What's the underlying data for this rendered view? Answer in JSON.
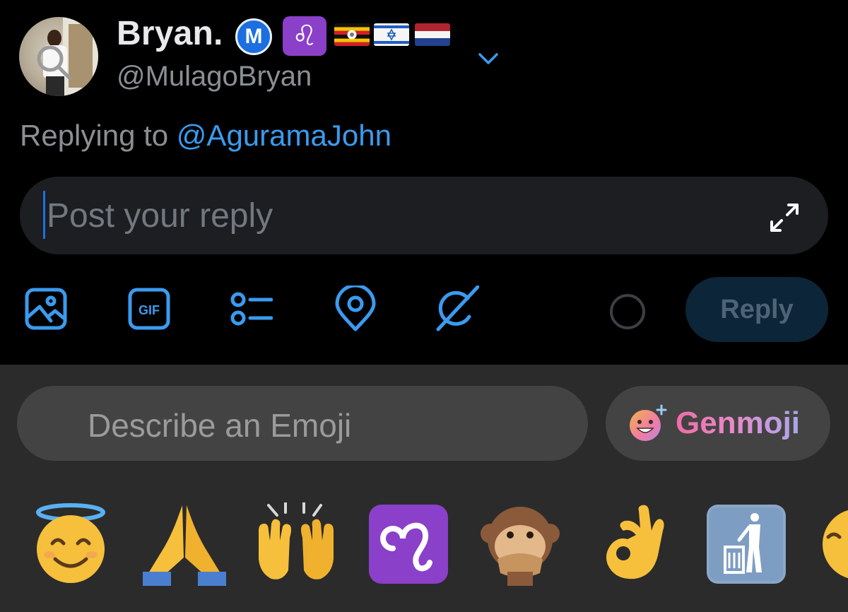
{
  "profile": {
    "display_name": "Bryan.",
    "badge_m": "M",
    "badge_leo": "♌",
    "handle": "@MulagoBryan"
  },
  "replying": {
    "prefix": "Replying to",
    "mention": "@AguramaJohn"
  },
  "composer": {
    "placeholder": "Post your reply",
    "reply_button": "Reply"
  },
  "toolbar": {
    "gif_label": "GIF",
    "icons": [
      "image-icon",
      "gif-icon",
      "poll-icon",
      "location-icon",
      "grok-icon"
    ]
  },
  "keyboard": {
    "search_placeholder": "Describe an Emoji",
    "genmoji_label": "Genmoji",
    "emojis": [
      "😇",
      "🙏",
      "🙌",
      "♌",
      "🙊",
      "👌",
      "🚮"
    ]
  },
  "colors": {
    "accent": "#3a9bef",
    "background": "#000000",
    "keyboard": "#2b2b2b",
    "reply_button_bg": "#0d2538"
  }
}
